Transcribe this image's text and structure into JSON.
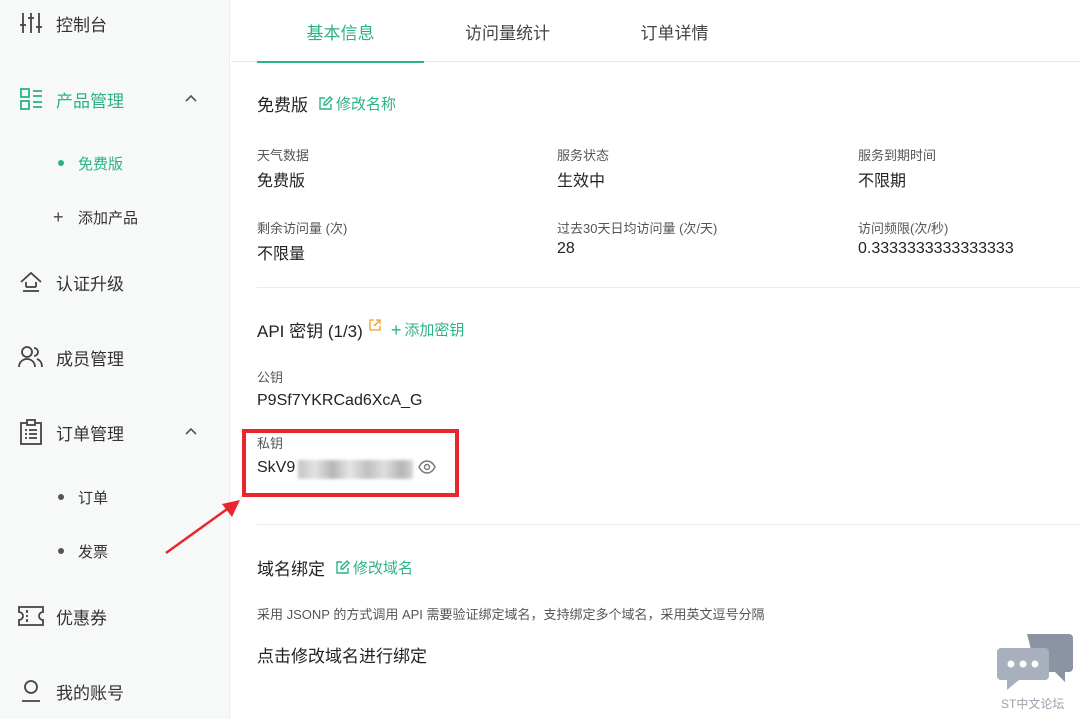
{
  "sidebar": {
    "items": [
      {
        "label": "控制台",
        "icon": "sliders-icon"
      },
      {
        "label": "产品管理",
        "icon": "grid-list-icon"
      },
      {
        "label": "认证升级",
        "icon": "upgrade-icon"
      },
      {
        "label": "成员管理",
        "icon": "users-icon"
      },
      {
        "label": "订单管理",
        "icon": "clipboard-icon"
      },
      {
        "label": "优惠券",
        "icon": "ticket-icon"
      },
      {
        "label": "我的账号",
        "icon": "user-icon"
      }
    ],
    "product_sub": [
      {
        "label": "免费版"
      },
      {
        "label": "添加产品"
      }
    ],
    "order_sub": [
      {
        "label": "订单"
      },
      {
        "label": "发票"
      }
    ]
  },
  "tabs": [
    {
      "label": "基本信息"
    },
    {
      "label": "访问量统计"
    },
    {
      "label": "订单详情"
    }
  ],
  "plan": {
    "title": "免费版",
    "rename_label": "修改名称"
  },
  "stats": [
    {
      "label": "天气数据",
      "value": "免费版"
    },
    {
      "label": "服务状态",
      "value": "生效中"
    },
    {
      "label": "服务到期时间",
      "value": "不限期"
    },
    {
      "label": "剩余访问量 (次)",
      "value": "不限量"
    },
    {
      "label": "过去30天日均访问量 (次/天)",
      "value": "28"
    },
    {
      "label": "访问频限(次/秒)",
      "value": "0.3333333333333333"
    }
  ],
  "api": {
    "title": "API 密钥 (1/3)",
    "add_key_label": "添加密钥",
    "public_key_label": "公钥",
    "public_key_value": "P9Sf7YKRCad6XcA_G",
    "private_key_label": "私钥",
    "private_key_prefix": "SkV9"
  },
  "domain": {
    "title": "域名绑定",
    "edit_label": "修改域名",
    "description": "采用 JSONP 的方式调用 API 需要验证绑定域名，支持绑定多个域名，采用英文逗号分隔",
    "placeholder_text": "点击修改域名进行绑定"
  },
  "watermark": {
    "text": "ST中文论坛"
  },
  "colors": {
    "accent": "#2bb385",
    "highlight": "#e8262d",
    "external_link": "#f0a020"
  }
}
